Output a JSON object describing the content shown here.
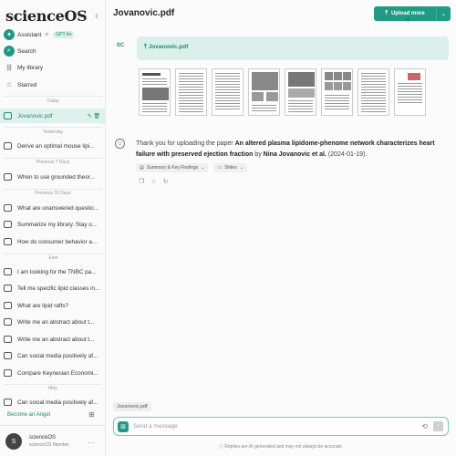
{
  "sidebar": {
    "brand": "scienceOS",
    "collapse_icon": "‹",
    "nav": {
      "assistant": "Assistant",
      "gpt_badge": "GPT-4o",
      "search": "Search",
      "library": "My library",
      "starred": "Starred"
    },
    "sections": {
      "today": "Today",
      "yesterday": "Yesterday",
      "prev7": "Previous 7 Days",
      "prev30": "Previous 30 Days",
      "june": "June",
      "may": "May"
    },
    "chats": {
      "c0": "Jovanovic.pdf",
      "c1": "Derive an optimal mouse lipi...",
      "c2": "When to use grounded theor...",
      "c3": "What are unanswered questio...",
      "c4": "Summarize my library. Stay o...",
      "c5": "How do consumer behavior a...",
      "c6": "I am looking for the TNBC pa...",
      "c7": "Tell me specific lipid classes in...",
      "c8": "What are lipid rafts?",
      "c9": "Write me an abstract about t...",
      "c10": "Write me an abstract about t...",
      "c11": "Can social media positively af...",
      "c12": "Compare Keynesian Economi...",
      "c13": "Can social media positively af..."
    },
    "angel": "Become an Angel",
    "user": {
      "initial": "S",
      "name": "scienceOS",
      "role": "scienceOS Member"
    }
  },
  "main": {
    "title": "Jovanovic.pdf",
    "upload_label": "Upload more",
    "sc_badge": "SC",
    "file_link": "Jovanovic.pdf",
    "reply": {
      "prefix": "Thank you for uploading the paper ",
      "paper_title": "An altered plasma lipidome-phenome network characterizes heart failure with preserved ejection fraction",
      "by": " by ",
      "authors": "Nina Jovanovic et al.",
      "date": " (2024-01-19)."
    },
    "chips": {
      "summary": "Summary & Key Findings",
      "slides": "Slides"
    },
    "file_chip": "Jovanovic.pdf",
    "composer_placeholder": "Send a message",
    "disclaimer": "Replies are AI-generated and may not always be accurate."
  }
}
